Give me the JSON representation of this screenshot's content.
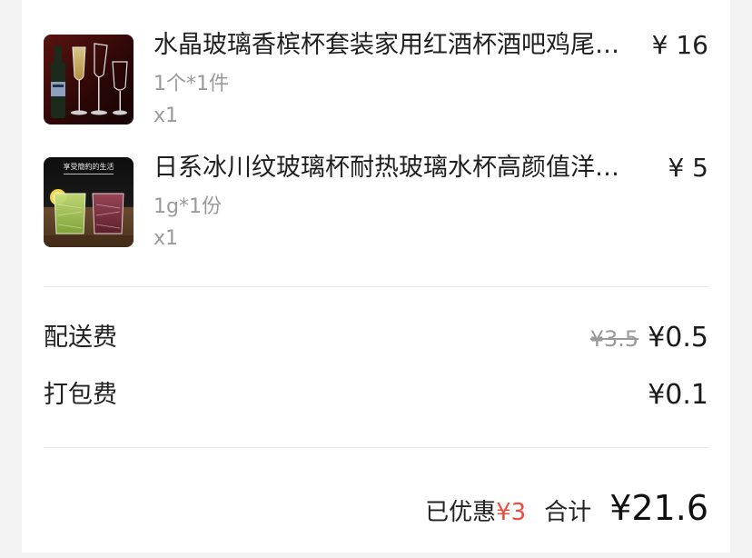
{
  "items": [
    {
      "title": "水晶玻璃香槟杯套装家用红酒杯酒吧鸡尾酒杯",
      "price": "¥ 16",
      "spec": "1个*1件",
      "qty": "x1",
      "thumb_icon": "champagne-glass-photo-icon"
    },
    {
      "title": "日系冰川纹玻璃杯耐热玻璃水杯高颜值洋酒杯",
      "price": "¥ 5",
      "spec": "1g*1份",
      "qty": "x1",
      "thumb_icon": "glacier-glass-cup-photo-icon",
      "thumb_caption": "享受簡約的生活"
    }
  ],
  "fees": {
    "delivery": {
      "label": "配送费",
      "original": "¥3.5",
      "value": "¥0.5"
    },
    "packing": {
      "label": "打包费",
      "value": "¥0.1"
    }
  },
  "summary": {
    "discount_label": "已优惠",
    "discount_value": "¥3",
    "total_label": "合计",
    "total_value": "¥21.6"
  },
  "colors": {
    "discount": "#ef4b3c",
    "muted": "#9a9a9a",
    "page_bg": "#f3f3f3"
  }
}
